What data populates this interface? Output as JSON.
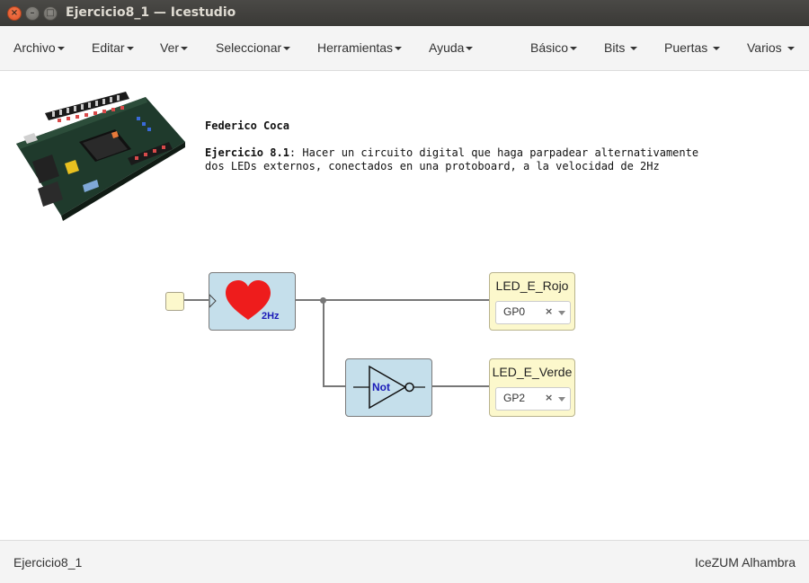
{
  "window": {
    "title": "Ejercicio8_1 — Icestudio",
    "close_glyph": "×",
    "minimize_glyph": "–",
    "maximize_glyph": "□"
  },
  "menu": {
    "left": [
      "Archivo",
      "Editar",
      "Ver",
      "Seleccionar",
      "Herramientas",
      "Ayuda"
    ],
    "right": [
      "Básico",
      "Bits",
      "Puertas",
      "Varios"
    ]
  },
  "comment": {
    "author": "Federico Coca",
    "exercise_label": "Ejercicio 8.1",
    "line1_rest": ": Hacer un circuito digital que haga parpadear alternativamente",
    "line2": "dos LEDs externos, conectados en una protoboard, a la velocidad de 2Hz"
  },
  "heart_block": {
    "label": "2Hz",
    "color": "#ee1c1c",
    "icon": "heart-icon"
  },
  "not_block": {
    "label": "Not",
    "icon": "not-gate-icon",
    "label_color": "#1a1ab8"
  },
  "led_red": {
    "name": "LED_E_Rojo",
    "value": "GP0",
    "clear_glyph": "×"
  },
  "led_green": {
    "name": "LED_E_Verde",
    "value": "GP2",
    "clear_glyph": "×"
  },
  "status": {
    "project": "Ejercicio8_1",
    "board": "IceZUM Alhambra"
  },
  "colors": {
    "block_fill": "#c5dfeb",
    "io_fill": "#fcf8cc",
    "wire": "#777777",
    "titlebar": "#3c3b37"
  }
}
